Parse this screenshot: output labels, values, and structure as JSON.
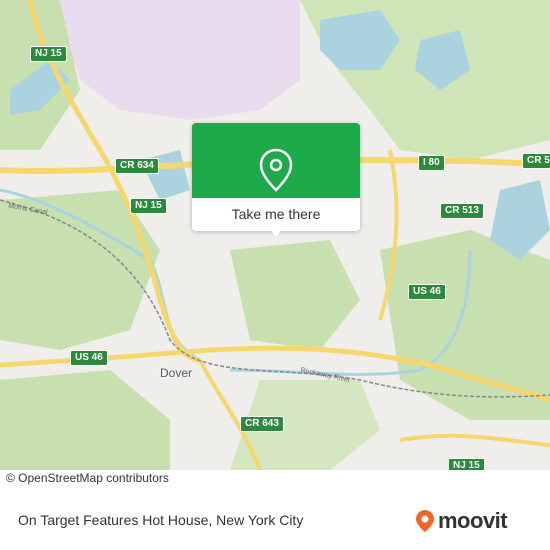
{
  "map": {
    "place_labels": [
      {
        "name": "Dover"
      }
    ],
    "road_shields": [
      {
        "label": "NJ 15"
      },
      {
        "label": "CR 634"
      },
      {
        "label": "I 80"
      },
      {
        "label": "CR 513"
      },
      {
        "label": "NJ 15"
      },
      {
        "label": "US 46"
      },
      {
        "label": "US 46"
      },
      {
        "label": "CR 643"
      },
      {
        "label": "CR 5"
      },
      {
        "label": "NJ 15"
      }
    ],
    "road_labels": [
      {
        "label": "Morris Canal"
      },
      {
        "label": "Rockaway River"
      }
    ],
    "attribution": "© OpenStreetMap contributors",
    "colors": {
      "water": "#aad3df",
      "forest": "#c8e0b0",
      "road_major": "#f5d76e",
      "shield": "#2d8a3c",
      "accent": "#1ea94a"
    }
  },
  "popup": {
    "icon": "location-pin-icon",
    "button_label": "Take me there"
  },
  "footer": {
    "title": "On Target Features Hot House, New York City",
    "brand": "moovit",
    "brand_color": "#f26522"
  }
}
